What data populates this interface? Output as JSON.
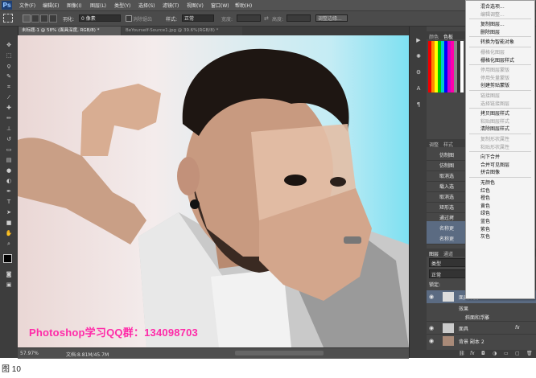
{
  "app": {
    "logo": "Ps"
  },
  "menubar": {
    "items": [
      "文件(F)",
      "编辑(E)",
      "图像(I)",
      "图层(L)",
      "类型(Y)",
      "选择(S)",
      "滤镜(T)",
      "视图(V)",
      "窗口(W)",
      "帮助(H)"
    ]
  },
  "options": {
    "feather_label": "羽化:",
    "feather_value": "0 像素",
    "antialias_label": "消除锯齿",
    "style_label": "样式:",
    "style_value": "正常",
    "width_label": "宽度:",
    "height_label": "高度:",
    "refine_edge": "调整边缘..."
  },
  "tabs": [
    {
      "label": "未标题-1 @ 58% (面具深度, RGB/8) *",
      "active": true
    },
    {
      "label": "BeYourself-Source1.jpg @ 39.6%(RGB/8) *",
      "active": false
    }
  ],
  "status": {
    "zoom": "57.97%",
    "doc": "文档:8.81M/45.7M"
  },
  "watermark": "Photoshop学习QQ群：134098703",
  "caption": "图 10",
  "right_panel": {
    "swatch_tabs": [
      "颜色",
      "色板"
    ],
    "adjust_tabs": [
      "调整",
      "样式"
    ],
    "layer_tabs": [
      "图层",
      "通道"
    ],
    "kind_label": "类型",
    "blend_mode": "正常",
    "lock_label": "锁定:",
    "history_items": [
      "仿制图",
      "仿制图",
      "取消选",
      "载入选",
      "取消选",
      "矩形选",
      "通过拷",
      "名称更",
      "名称更"
    ],
    "layers": [
      {
        "name": "面具深度",
        "fx": "fx"
      },
      {
        "name": "效果",
        "fx": ""
      },
      {
        "name": "斜面和浮雕",
        "fx": ""
      },
      {
        "name": "面具",
        "fx": "fx"
      },
      {
        "name": "背景 副本 2",
        "fx": ""
      }
    ]
  },
  "context_menu": {
    "items": [
      {
        "label": "混合选项...",
        "enabled": true
      },
      {
        "label": "编辑调整...",
        "enabled": false
      },
      {
        "sep": true
      },
      {
        "label": "复制图层...",
        "enabled": true
      },
      {
        "label": "删除图层",
        "enabled": true
      },
      {
        "sep": true
      },
      {
        "label": "转换为智能对象",
        "enabled": true
      },
      {
        "sep": true
      },
      {
        "label": "栅格化图层",
        "enabled": false
      },
      {
        "label": "栅格化图层样式",
        "enabled": true
      },
      {
        "sep": true
      },
      {
        "label": "停用图层蒙版",
        "enabled": false
      },
      {
        "label": "停用矢量蒙版",
        "enabled": false
      },
      {
        "label": "创建剪贴蒙版",
        "enabled": true
      },
      {
        "sep": true
      },
      {
        "label": "链接图层",
        "enabled": false
      },
      {
        "label": "选择链接图层",
        "enabled": false
      },
      {
        "sep": true
      },
      {
        "label": "拷贝图层样式",
        "enabled": true
      },
      {
        "label": "粘贴图层样式",
        "enabled": false
      },
      {
        "label": "清除图层样式",
        "enabled": true
      },
      {
        "sep": true
      },
      {
        "label": "复制形状属性",
        "enabled": false
      },
      {
        "label": "粘贴形状属性",
        "enabled": false
      },
      {
        "sep": true
      },
      {
        "label": "向下合并",
        "enabled": true
      },
      {
        "label": "合并可见图层",
        "enabled": true
      },
      {
        "label": "拼合图像",
        "enabled": true
      },
      {
        "sep": true
      },
      {
        "label": "无颜色",
        "enabled": true
      },
      {
        "label": "红色",
        "enabled": true
      },
      {
        "label": "橙色",
        "enabled": true
      },
      {
        "label": "黄色",
        "enabled": true
      },
      {
        "label": "绿色",
        "enabled": true
      },
      {
        "label": "蓝色",
        "enabled": true
      },
      {
        "label": "紫色",
        "enabled": true
      },
      {
        "label": "灰色",
        "enabled": true
      }
    ]
  }
}
